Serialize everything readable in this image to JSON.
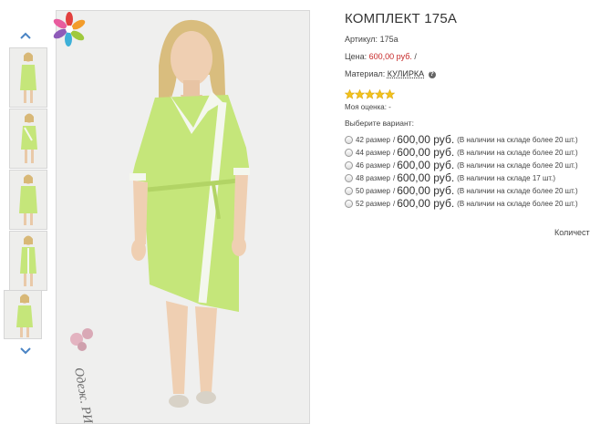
{
  "product": {
    "title": "КОМПЛЕКТ 175А",
    "article_label": "Артикул:",
    "article_value": "175а",
    "price_label": "Цена:",
    "price_value": "600,00 руб.",
    "price_sep": "/",
    "material_label": "Материал:",
    "material_value": "КУЛИРКА",
    "help_glyph": "?",
    "rating_stars": 5,
    "my_rating_label": "Моя оценка:",
    "my_rating_value": "-",
    "choose_label": "Выберите вариант:",
    "quantity_label": "Количест"
  },
  "variants": [
    {
      "size": "42 размер",
      "sep": "/",
      "price": "600,00 руб.",
      "stock": "(В наличии на складе более 20 шт.)"
    },
    {
      "size": "44 размер",
      "sep": "/",
      "price": "600,00 руб.",
      "stock": "(В наличии на складе более 20 шт.)"
    },
    {
      "size": "46 размер",
      "sep": "/",
      "price": "600,00 руб.",
      "stock": "(В наличии на складе более 20 шт.)"
    },
    {
      "size": "48 размер",
      "sep": "/",
      "price": "600,00 руб.",
      "stock": "(В наличии на складе 17 шт.)"
    },
    {
      "size": "50 размер",
      "sep": "/",
      "price": "600,00 руб.",
      "stock": "(В наличии на складе более 20 шт.)"
    },
    {
      "size": "52 размер",
      "sep": "/",
      "price": "600,00 руб.",
      "stock": "(В наличии на складе более 20 шт.)"
    }
  ],
  "gallery": {
    "thumb_count": 5,
    "watermark": "Одеж. РИО"
  },
  "colors": {
    "price": "#c62828",
    "garment": "#c5e67a",
    "trim": "#f4f7ee",
    "star": "#f2c21b"
  }
}
